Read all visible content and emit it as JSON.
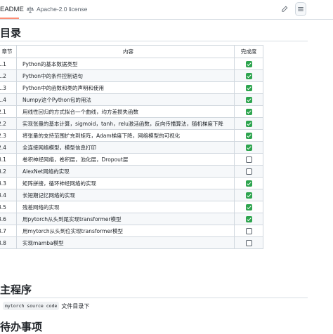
{
  "tabs": {
    "readme": "EADME",
    "license": "Apache-2.0 license"
  },
  "toc": {
    "heading": "目录",
    "headers": {
      "chapter": "章节",
      "content": "内容",
      "done": "完成度"
    },
    "rows": [
      {
        "ch": "1.1",
        "content": "Python的基本数据类型",
        "done": true
      },
      {
        "ch": "1.2",
        "content": "Python中的条件控制语句",
        "done": true
      },
      {
        "ch": "1.3",
        "content": "Python中的函数和类的声明和使用",
        "done": true
      },
      {
        "ch": "1.4",
        "content": "Numpy这个Python包的用法",
        "done": true
      },
      {
        "ch": "2.1",
        "content": "用线性回归的方式拟合一个曲线，均方差损失函数",
        "done": true
      },
      {
        "ch": "2.2",
        "content": "实现张量的基本计算，sigmoid，tanh，relu激活函数，反向传播算法，随机梯度下降",
        "done": true
      },
      {
        "ch": "2.3",
        "content": "将张量的支持范围扩充到矩阵，Adam梯度下降，网络模型的可视化",
        "done": true
      },
      {
        "ch": "2.4",
        "content": "全连接网络模型，模型信息打印",
        "done": true
      },
      {
        "ch": "3.1",
        "content": "卷积神经网络，卷积层，池化层，Dropout层",
        "done": false
      },
      {
        "ch": "3.2",
        "content": "AlexNet网络的实现",
        "done": false
      },
      {
        "ch": "3.3",
        "content": "矩阵拼接，循环神经网络的实现",
        "done": true
      },
      {
        "ch": "3.4",
        "content": "长短期记忆网络的实现",
        "done": true
      },
      {
        "ch": "3.5",
        "content": "残差网络的实现",
        "done": true
      },
      {
        "ch": "3.6",
        "content": "用pytorch从头到尾实现transformer模型",
        "done": true
      },
      {
        "ch": "3.7",
        "content": "用mytorch从头到位实现transformer模型",
        "done": false
      },
      {
        "ch": "3.8",
        "content": "实现mamba模型",
        "done": false
      }
    ]
  },
  "main": {
    "heading": "主程序",
    "code": "mytorch source code",
    "text": "文件目录下"
  },
  "todo": {
    "heading": "待办事项"
  },
  "colors": {
    "check": "#2da44e",
    "tab_accent": "#fd8c73"
  },
  "icons": {
    "license": "scale-icon",
    "edit": "pencil-icon",
    "menu": "list-icon"
  }
}
